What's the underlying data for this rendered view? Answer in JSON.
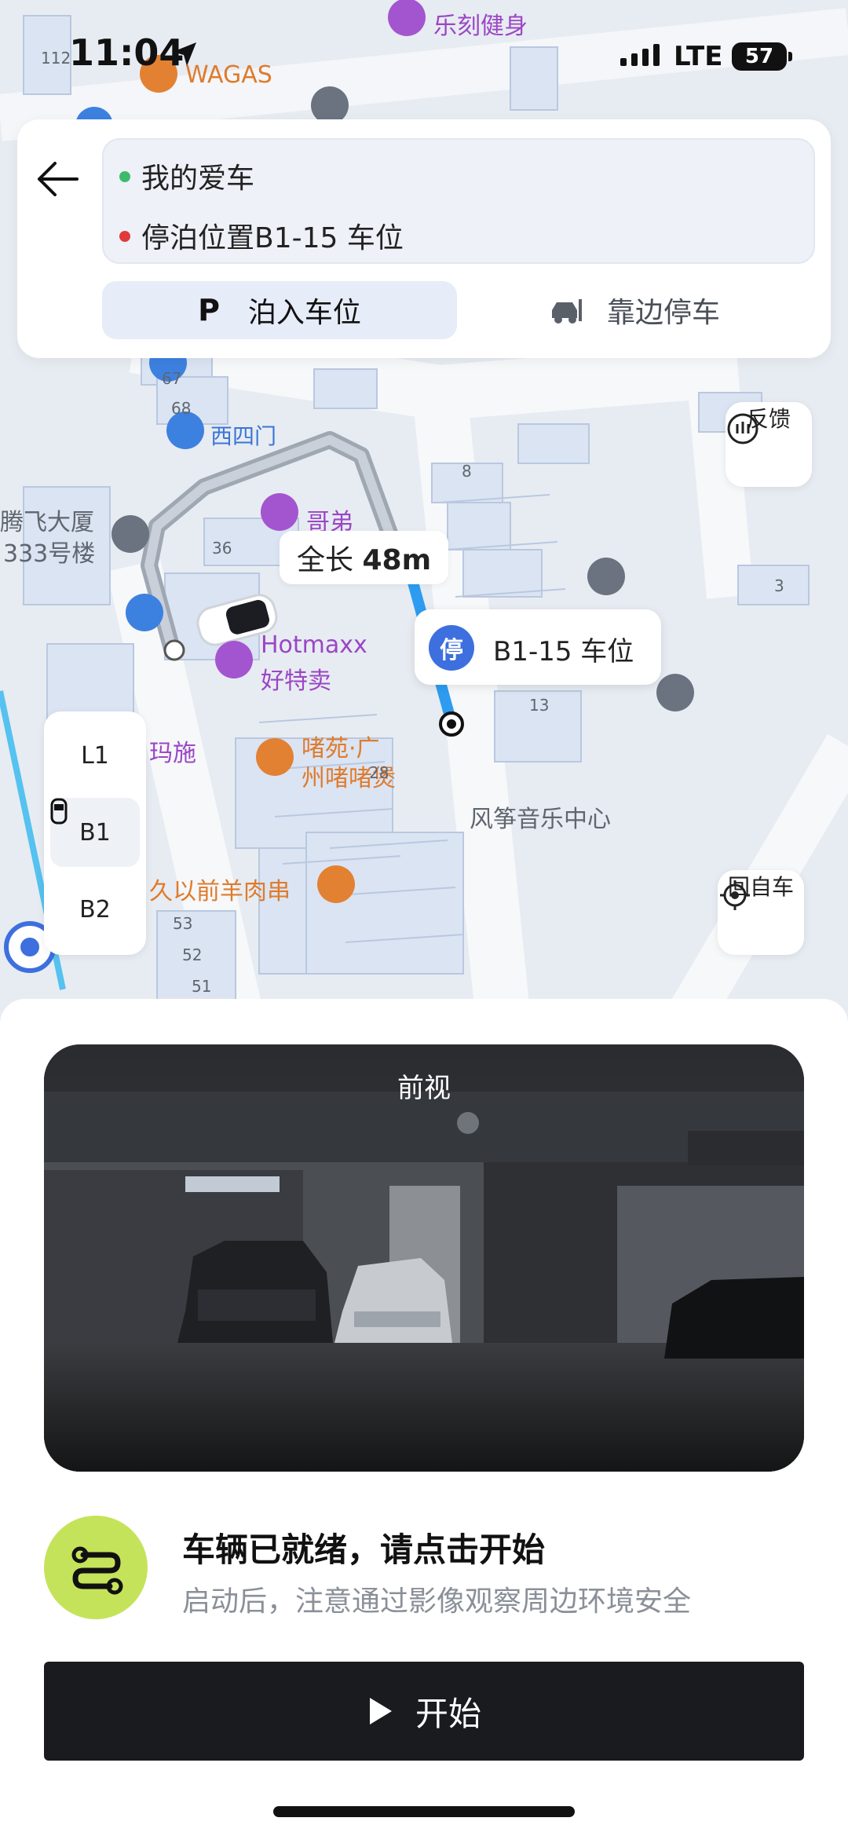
{
  "status_bar": {
    "time": "11:04",
    "network": "LTE",
    "battery": "57"
  },
  "map": {
    "labels": {
      "lekejianshen": "乐刻健身",
      "wagas": "WAGAS",
      "num_112": "112",
      "num_67": "67",
      "num_68": "68",
      "xisimen": "西四门",
      "num_8": "8",
      "tengfei_line1": "腾飞大厦",
      "tengfei_line2": "333号楼",
      "num_36": "36",
      "gedi": "哥弟",
      "num_3": "3",
      "hotmaxx_line1": "Hotmaxx",
      "hotmaxx_line2": "好特卖",
      "num_13": "13",
      "mashi": "玛施",
      "zhuyuan_line1": "啫苑·广",
      "zhuyuan_line2": "州啫啫煲",
      "num_28": "28",
      "fengzheng": "风筝音乐中心",
      "jiuyiqian": "久以前羊肉串",
      "num_53": "53",
      "num_52": "52",
      "num_51": "51"
    },
    "distance_prefix": "全长",
    "distance_value": "48m",
    "target_badge": "停",
    "target_label": "B1-15 车位",
    "feedback_label": "反馈",
    "return_car_label": "回自车",
    "floors": [
      "L1",
      "B1",
      "B2"
    ],
    "active_floor": "B1"
  },
  "route": {
    "origin": "我的爱车",
    "destination": "停泊位置B1-15 车位",
    "modes": [
      "泊入车位",
      "靠边停车"
    ],
    "active_mode": "泊入车位",
    "mode_icons": [
      "P",
      "car-side-icon"
    ]
  },
  "camera": {
    "title": "前视",
    "pages": 3,
    "active_page": 1
  },
  "status": {
    "title": "车辆已就绪，请点击开始",
    "subtitle": "启动后，注意通过影像观察周边环境安全"
  },
  "start_button": {
    "label": "开始"
  },
  "colors": {
    "accent": "#c5e35a",
    "blue": "#3d6fde",
    "route": "#2d9cf0"
  }
}
